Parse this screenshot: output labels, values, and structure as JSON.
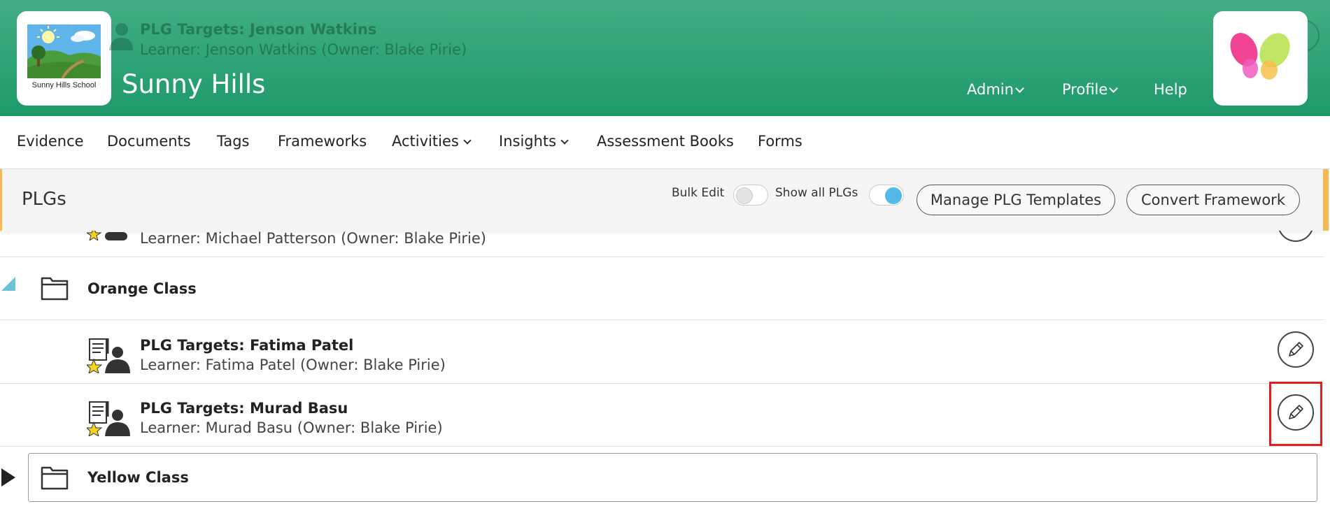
{
  "header": {
    "school_name": "Sunny Hills",
    "school_logo_caption": "Sunny Hills School",
    "background_ghost": {
      "title": "PLG Targets: Jenson Watkins",
      "subtitle": "Learner: Jenson Watkins (Owner: Blake Pirie)"
    },
    "nav": {
      "admin": "Admin",
      "profile": "Profile",
      "help": "Help"
    }
  },
  "subnav": {
    "evidence": "Evidence",
    "documents": "Documents",
    "tags": "Tags",
    "frameworks": "Frameworks",
    "activities": "Activities",
    "insights": "Insights",
    "assessment_books": "Assessment Books",
    "forms": "Forms"
  },
  "toolbar": {
    "title": "PLGs",
    "bulk_edit_label": "Bulk Edit",
    "bulk_edit_on": false,
    "show_all_label": "Show all PLGs",
    "show_all_on": true,
    "manage_templates": "Manage PLG Templates",
    "convert_framework": "Convert Framework"
  },
  "list": {
    "partial_row": {
      "subtitle": "Learner: Michael Patterson (Owner: Blake Pirie)"
    },
    "orange_class": {
      "name": "Orange Class",
      "expanded": true
    },
    "rows": [
      {
        "title": "PLG Targets: Fatima Patel",
        "subtitle": "Learner: Fatima Patel (Owner: Blake Pirie)"
      },
      {
        "title": "PLG Targets: Murad Basu",
        "subtitle": "Learner: Murad Basu (Owner: Blake Pirie)"
      }
    ],
    "yellow_class": {
      "name": "Yellow Class",
      "expanded": false
    }
  },
  "colors": {
    "header_green": "#2fa374",
    "toolbar_accent": "#f6b850",
    "toggle_on": "#52b9e8",
    "highlight_red": "#e02020",
    "expand_arrow": "#6cc3d5"
  }
}
